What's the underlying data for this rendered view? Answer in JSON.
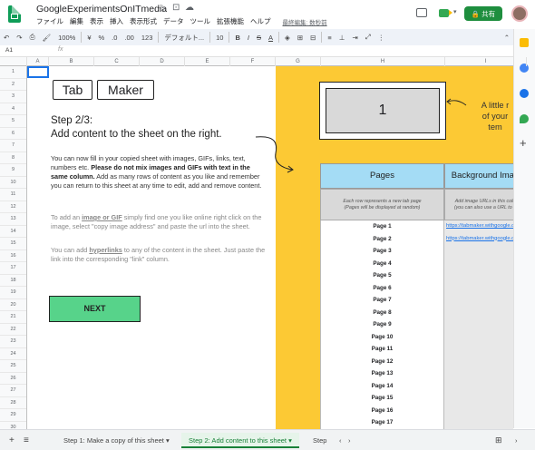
{
  "app": {
    "title": "GoogleExperimentsOnITmedia",
    "menu": [
      "ファイル",
      "編集",
      "表示",
      "挿入",
      "表示形式",
      "データ",
      "ツール",
      "拡張機能",
      "ヘルプ"
    ],
    "last_edit": "最終編集: 数秒前",
    "share_label": "共有",
    "accent_color": "#1e8e3e"
  },
  "toolbar": {
    "zoom": "100%",
    "currency": "¥",
    "percent": "%",
    "dec_minus": ".0",
    "dec_plus": ".00",
    "number_format": "123",
    "font": "デフォルト...",
    "font_size": "10",
    "bold": "B",
    "italic": "I",
    "strike": "S",
    "text_color": "A"
  },
  "formula": {
    "name_box": "A1",
    "fx": "fx"
  },
  "columns": [
    "A",
    "B",
    "C",
    "D",
    "E",
    "F",
    "G",
    "H",
    "I"
  ],
  "rows": [
    "1",
    "2",
    "3",
    "4",
    "5",
    "6",
    "7",
    "8",
    "9",
    "10",
    "11",
    "12",
    "13",
    "14",
    "15",
    "16",
    "17",
    "18",
    "19",
    "20",
    "21",
    "22",
    "23",
    "24",
    "25",
    "26",
    "27",
    "28",
    "29",
    "30"
  ],
  "left": {
    "tab": "Tab",
    "maker": "Maker",
    "step": "Step 2/3:",
    "headline": "Add content to the sheet on the right.",
    "p1_a": "You can now fill in your copied sheet with images, GIFs, links, text, numbers etc. ",
    "p1_bold": "Please do not mix images and GIFs with text in the same column.",
    "p1_b": " Add as many rows of content as you like and remember you can return to this sheet at any time to edit, add and remove content.",
    "p2_a": "To add an ",
    "p2_bold": "image or GIF",
    "p2_b": " simply find one you like online right click on the image, select \"copy image address\" and paste the url into the sheet.",
    "p3_a": "You can add ",
    "p3_bold": "hyperlinks",
    "p3_b": " to any of the content in the sheet. Just paste the link into the corresponding \"link\" column.",
    "next": "NEXT"
  },
  "right": {
    "preview_number": "1",
    "note": "A little r... of your ... tem...",
    "note_line1": "A little r",
    "note_line2": "of your",
    "note_line3": "tem",
    "col_pages": "Pages",
    "col_bg": "Background Imag",
    "desc_pages": "Each row represents a new tab page\n(Pages will be displayed at random)",
    "desc_bg": "Add image URLs in this colu\n(you can also use a URL to a",
    "pages": [
      "Page 1",
      "Page 2",
      "Page 3",
      "Page 4",
      "Page 5",
      "Page 6",
      "Page 7",
      "Page 8",
      "Page 9",
      "Page 10",
      "Page 11",
      "Page 12",
      "Page 13",
      "Page 14",
      "Page 15",
      "Page 16",
      "Page 17"
    ],
    "urls": [
      "https://tabmaker.withgoogle.co",
      "https://tabmaker.withgoogle.co"
    ]
  },
  "sheets": {
    "add": "+",
    "list": "≡",
    "tab1": "Step 1: Make a copy of this sheet",
    "tab2": "Step 2: Add content to this sheet",
    "tab3": "Step",
    "active_color": "#188038"
  }
}
